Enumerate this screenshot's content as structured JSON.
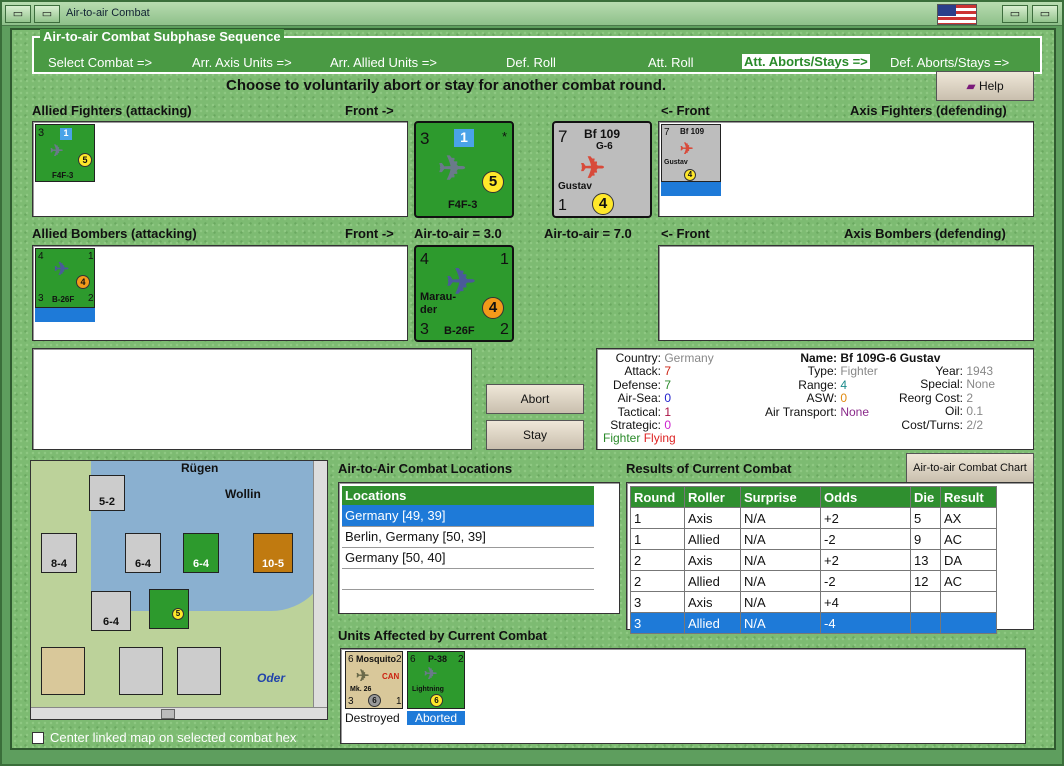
{
  "window": {
    "title": "Air-to-air Combat"
  },
  "sequence": {
    "title": "Air-to-air Combat Subphase Sequence",
    "steps": [
      "Select Combat =>",
      "Arr. Axis Units =>",
      "Arr. Allied Units =>",
      "Def. Roll",
      "Att. Roll",
      "Att. Aborts/Stays =>",
      "Def. Aborts/Stays =>"
    ],
    "active_index": 5
  },
  "instruction": "Choose to voluntarily abort or stay for another combat round.",
  "help_label": "Help",
  "sections": {
    "allied_fighters": "Allied Fighters (attacking)",
    "front_right": "Front ->",
    "front_left": "<- Front",
    "axis_fighters": "Axis Fighters (defending)",
    "allied_bombers": "Allied Bombers (attacking)",
    "front_right2": "Front ->",
    "air_allied": "Air-to-air = 3.0",
    "air_axis": "Air-to-air = 7.0",
    "front_left2": "<- Front",
    "axis_bombers": "Axis Bombers (defending)"
  },
  "units": {
    "f4f": {
      "name": "F4F-3",
      "tl": "3",
      "badge": "1",
      "circle": "5",
      "star": "*"
    },
    "bf109": {
      "name": "Bf 109",
      "sub": "G-6",
      "nick": "Gustav",
      "tl": "7",
      "bl": "1",
      "circle": "4",
      "star": "*"
    },
    "b26": {
      "name": "B-26F",
      "nick1": "Marau-",
      "nick2": "der",
      "tl": "4",
      "tr": "1",
      "bl": "3",
      "br": "2",
      "circle": "4"
    }
  },
  "buttons": {
    "abort": "Abort",
    "stay": "Stay",
    "chart": "Air-to-air Combat Chart"
  },
  "info": {
    "country_l": "Country:",
    "country_v": "Germany",
    "attack_l": "Attack:",
    "attack_v": "7",
    "defense_l": "Defense:",
    "defense_v": "7",
    "airsea_l": "Air-Sea:",
    "airsea_v": "0",
    "tactical_l": "Tactical:",
    "tactical_v": "1",
    "strategic_l": "Strategic:",
    "strategic_v": "0",
    "status1": "Fighter",
    "status2": "Flying",
    "name_l": "Name:",
    "name_v": "Bf 109G-6 Gustav",
    "type_l": "Type:",
    "type_v": "Fighter",
    "range_l": "Range:",
    "range_v": "4",
    "asw_l": "ASW:",
    "asw_v": "0",
    "airt_l": "Air Transport:",
    "airt_v": "None",
    "year_l": "Year:",
    "year_v": "1943",
    "special_l": "Special:",
    "special_v": "None",
    "reorg_l": "Reorg Cost:",
    "reorg_v": "2",
    "oil_l": "Oil:",
    "oil_v": "0.1",
    "cost_l": "Cost/Turns:",
    "cost_v": "2/2"
  },
  "locations": {
    "title": "Air-to-Air Combat Locations",
    "header": "Locations",
    "rows": [
      "Germany [49, 39]",
      "Berlin, Germany [50, 39]",
      "Germany [50, 40]"
    ],
    "selected": 0
  },
  "results": {
    "title": "Results of Current Combat",
    "headers": [
      "Round",
      "Roller",
      "Surprise",
      "Odds",
      "Die",
      "Result"
    ],
    "rows": [
      [
        "1",
        "Axis",
        "N/A",
        "+2",
        "5",
        "AX"
      ],
      [
        "1",
        "Allied",
        "N/A",
        "-2",
        "9",
        "AC"
      ],
      [
        "2",
        "Axis",
        "N/A",
        "+2",
        "13",
        "DA"
      ],
      [
        "2",
        "Allied",
        "N/A",
        "-2",
        "12",
        "AC"
      ],
      [
        "3",
        "Axis",
        "N/A",
        "+4",
        "",
        ""
      ],
      [
        "3",
        "Allied",
        "N/A",
        "-4",
        "",
        ""
      ]
    ],
    "selected": 5
  },
  "affected": {
    "title": "Units Affected by Current Combat",
    "mosquito": {
      "name": "Mosquito",
      "tl": "6",
      "tr": "2",
      "can": "CAN",
      "mk": "Mk. 26",
      "bl": "3",
      "c": "6",
      "br": "1",
      "status": "Destroyed"
    },
    "p38": {
      "name": "P-38",
      "tl": "6",
      "tr": "2",
      "nick": "Lightning",
      "c": "6",
      "status": "Aborted"
    }
  },
  "map": {
    "labels": [
      "Rügen",
      "Wollin",
      "Oder"
    ],
    "counters": [
      "5-2",
      "8-4",
      "6-4",
      "6-4",
      "10-5",
      "6-4"
    ],
    "checkbox_label": "Center linked map on selected combat hex"
  },
  "colors": {
    "accent": "#2f8f2f",
    "selection": "#1e7ad8",
    "panel": "#7dbb72"
  }
}
